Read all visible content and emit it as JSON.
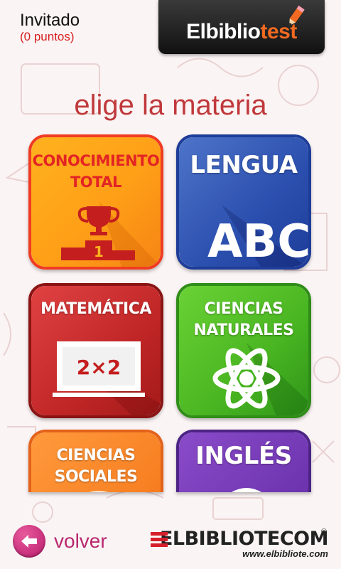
{
  "user": {
    "name": "Invitado",
    "points": "(0 puntos)"
  },
  "app": {
    "logo_main": "Elbiblio",
    "logo_accent": "test"
  },
  "heading": "elige la materia",
  "subjects": [
    {
      "label": "CONOCIMIENTO\nTOTAL",
      "icon": "trophy-podium-icon",
      "color": "#ff9f17"
    },
    {
      "label": "LENGUA",
      "icon": "abc-letters-icon",
      "color": "#2b4fae",
      "art_text": "ABC"
    },
    {
      "label": "MATEMÁTICA",
      "icon": "chalkboard-icon",
      "color": "#c12626",
      "art_text": "2×2"
    },
    {
      "label": "CIENCIAS\nNATURALES",
      "icon": "atom-icon",
      "color": "#49b521"
    },
    {
      "label": "CIENCIAS\nSOCIALES",
      "icon": "globe-icon",
      "color": "#f67d20"
    },
    {
      "label": "INGLÉS",
      "icon": "english-icon",
      "color": "#6c33ae"
    }
  ],
  "footer": {
    "back_label": "volver",
    "brand_name": "ELBIBLIOTECOM",
    "brand_url": "www.elbibliote.com",
    "brand_reg": "®"
  }
}
